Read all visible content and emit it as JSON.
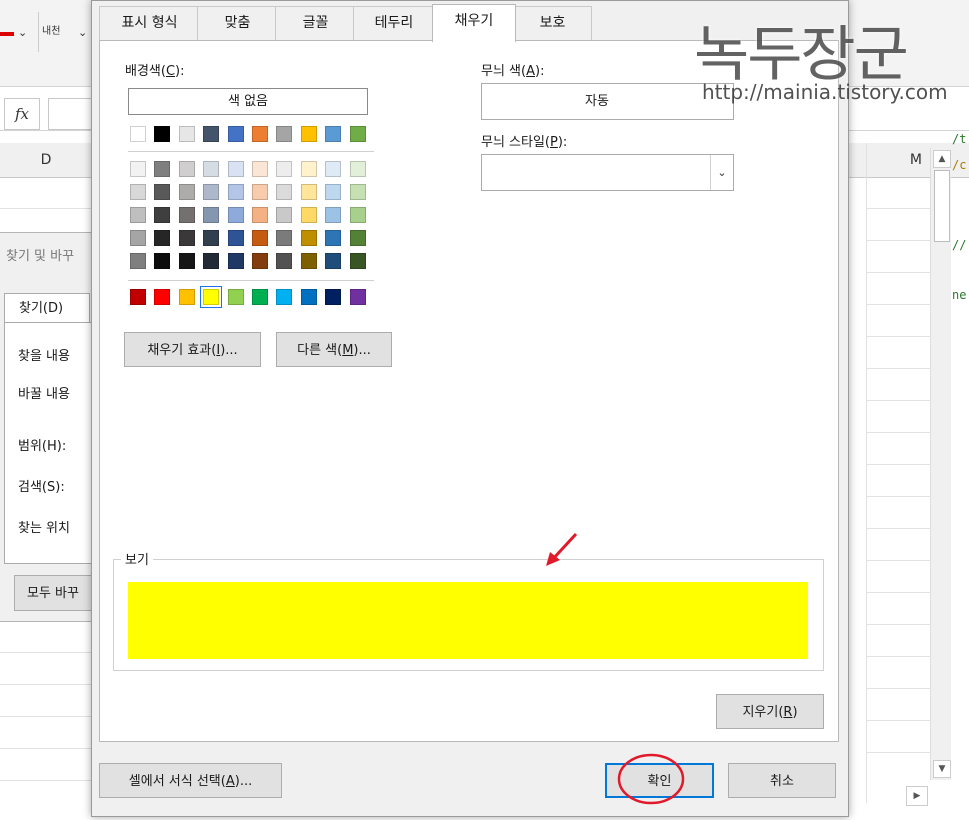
{
  "excel": {
    "formula_fx": "fx",
    "ribbon_small": "내천",
    "col_d": "D",
    "col_m": "M",
    "code_fragments": [
      "/t",
      "/c",
      "//",
      "ne"
    ]
  },
  "find_dialog": {
    "title": "찾기 및 바꾸",
    "tab_find": "찾기(D)",
    "label_find_what": "찾을 내용",
    "label_replace_with": "바꿀 내용",
    "label_within": "범위(H):",
    "label_search": "검색(S):",
    "label_look_in": "찾는 위치",
    "replace_all_button": "모두 바꾸"
  },
  "dialog": {
    "tabs": [
      "표시 형식",
      "맞춤",
      "글꼴",
      "테두리",
      "채우기",
      "보호"
    ],
    "active_tab": "채우기",
    "fill": {
      "background_color_label": "배경색(",
      "background_color_key": "C",
      "background_color_suffix": "):",
      "no_color_button": "색 없음",
      "fill_effects_button": "채우기 효과(",
      "fill_effects_key": "I",
      "fill_effects_suffix": ")...",
      "more_colors_button": "다른 색(",
      "more_colors_key": "M",
      "more_colors_suffix": ")...",
      "pattern_color_label": "무늬 색(",
      "pattern_color_key": "A",
      "pattern_color_suffix": "):",
      "pattern_color_value": "자동",
      "pattern_style_label": "무늬 스타일(",
      "pattern_style_key": "P",
      "pattern_style_suffix": "):",
      "pattern_style_value": "",
      "sample_label": "보기",
      "sample_color": "#FFFF00",
      "clear_button": "지우기(",
      "clear_key": "R",
      "clear_suffix": ")",
      "selected_color": "#FFFF00",
      "theme_top_row": [
        "#FFFFFF",
        "#000000",
        "#E7E6E6",
        "#44546A",
        "#4472C4",
        "#ED7D31",
        "#A5A5A5",
        "#FFC000",
        "#5B9BD5",
        "#70AD47"
      ],
      "theme_tints": [
        [
          "#F2F2F2",
          "#7F7F7F",
          "#D0CECE",
          "#D6DCE4",
          "#D9E2F3",
          "#FBE5D5",
          "#EDEDED",
          "#FFF2CC",
          "#DEEBF6",
          "#E2EFD9"
        ],
        [
          "#D8D8D8",
          "#595959",
          "#AEABAB",
          "#ADB9CA",
          "#B4C6E7",
          "#F7CBAC",
          "#DBDBDB",
          "#FEE599",
          "#BDD7EE",
          "#C5E0B3"
        ],
        [
          "#BFBFBF",
          "#3F3F3F",
          "#757070",
          "#8496B0",
          "#8EAADB",
          "#F4B183",
          "#C9C9C9",
          "#FFD965",
          "#9CC3E5",
          "#A8D08D"
        ],
        [
          "#A5A5A5",
          "#262626",
          "#3A3838",
          "#323F4F",
          "#2F5496",
          "#C55A11",
          "#7B7B7B",
          "#BF8F00",
          "#2E75B5",
          "#538135"
        ],
        [
          "#7F7F7F",
          "#0C0C0C",
          "#171616",
          "#222A35",
          "#1F3864",
          "#833C0B",
          "#525252",
          "#7F6000",
          "#1E4E79",
          "#375623"
        ]
      ],
      "standard_colors": [
        "#C00000",
        "#FF0000",
        "#FFC000",
        "#FFFF00",
        "#92D050",
        "#00B050",
        "#00B0F0",
        "#0070C0",
        "#002060",
        "#7030A0"
      ]
    },
    "pick_from_cell_button": "셀에서 서식 선택(",
    "pick_from_cell_key": "A",
    "pick_from_cell_suffix": ")...",
    "ok_button": "확인",
    "cancel_button": "취소"
  },
  "watermark": {
    "title": "녹두장군",
    "url": "http://mainia.tistory.com"
  },
  "annotation_color": "#E0192B"
}
